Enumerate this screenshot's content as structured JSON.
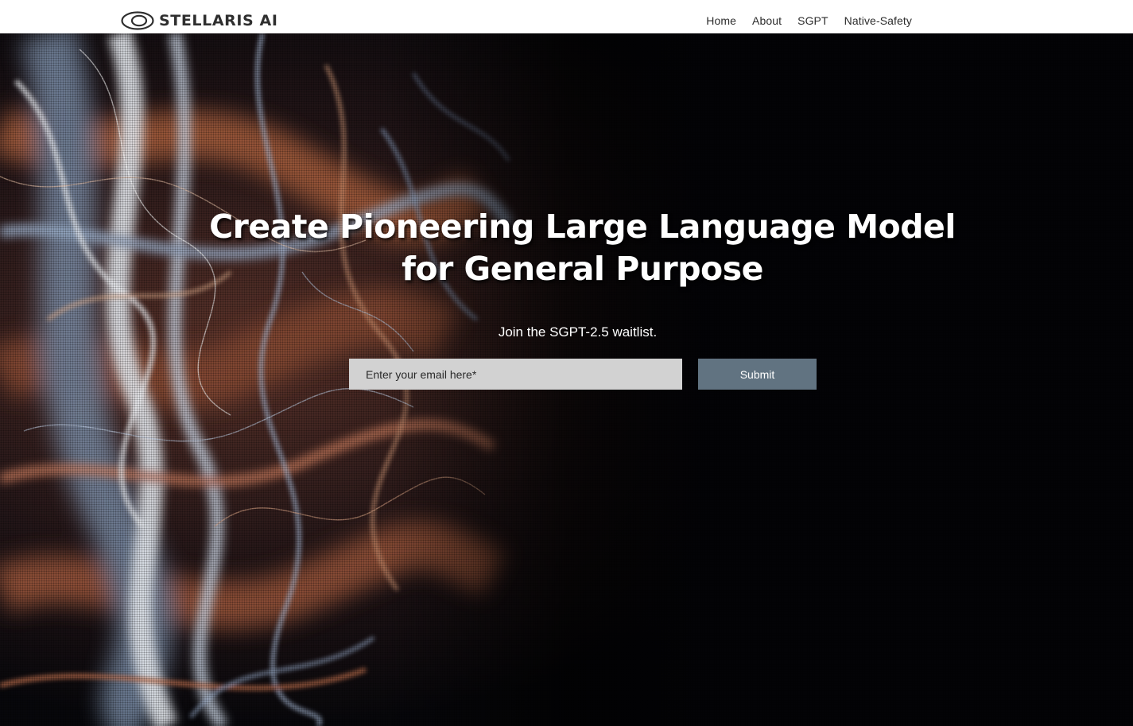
{
  "header": {
    "logo_text": "STELLARIS AI",
    "nav": [
      {
        "label": "Home"
      },
      {
        "label": "About"
      },
      {
        "label": "SGPT"
      },
      {
        "label": "Native-Safety"
      }
    ]
  },
  "hero": {
    "headline_line1": "Create Pioneering Large Language Model",
    "headline_line2": "for General Purpose",
    "subline": "Join the SGPT-2.5 waitlist.",
    "email_placeholder": "Enter your email here*",
    "email_value": "",
    "submit_label": "Submit"
  },
  "colors": {
    "header_bg": "#ffffff",
    "hero_bg": "#030306",
    "input_bg": "#d2d2d2",
    "button_bg": "#617381",
    "text_light": "#ffffff",
    "nav_text": "#2c2c2c"
  },
  "icons": {
    "logo": "stellaris-ring-logo-icon"
  }
}
